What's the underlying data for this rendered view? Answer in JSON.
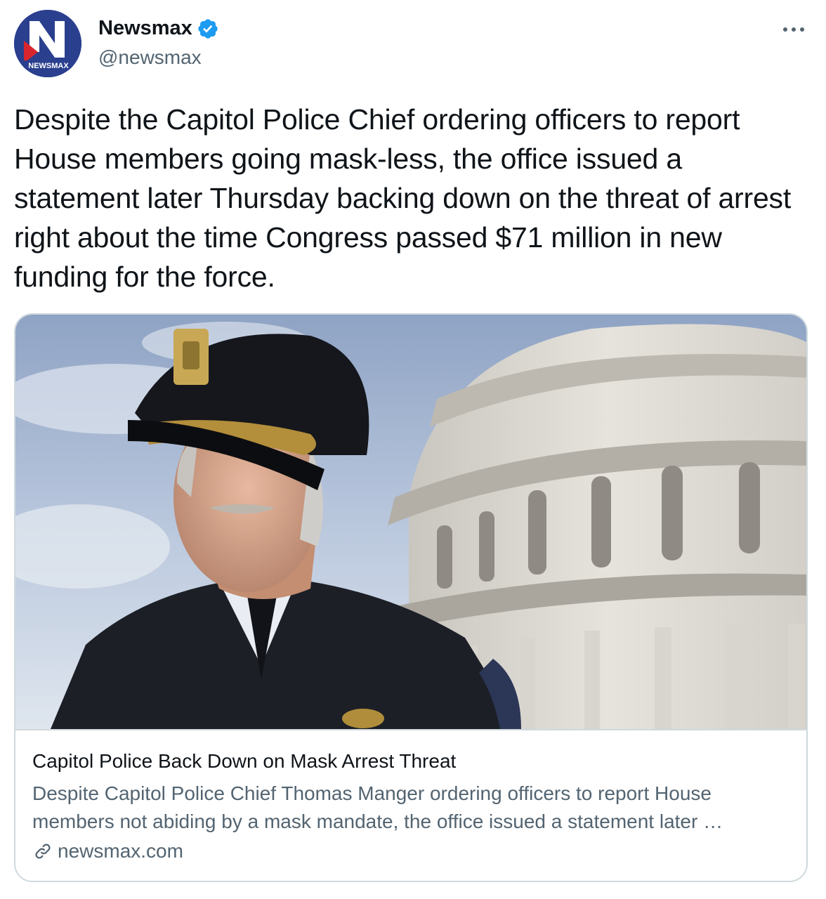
{
  "tweet": {
    "author": {
      "display_name": "Newsmax",
      "handle": "@newsmax",
      "verified": true,
      "avatar_logo_text": "NEWSMAX"
    },
    "more_icon": "more-horizontal-icon",
    "text": "Despite the Capitol Police Chief ordering officers to report House members going mask-less, the office issued a statement later Thursday backing down on the threat of arrest right about the time Congress passed $71 million in new funding for the force."
  },
  "card": {
    "title": "Capitol Police Back Down on Mask Arrest Threat",
    "description": "Despite Capitol Police Chief Thomas Manger ordering officers to report House members not abiding by a mask mandate, the office issued a statement later …",
    "domain": "newsmax.com",
    "domain_icon": "link-icon"
  },
  "colors": {
    "text_primary": "#0f1419",
    "text_secondary": "#536471",
    "border": "#cfd9de",
    "verified_blue": "#1d9bf0",
    "avatar_blue": "#2b3f8f",
    "brand_red": "#d9262e"
  }
}
